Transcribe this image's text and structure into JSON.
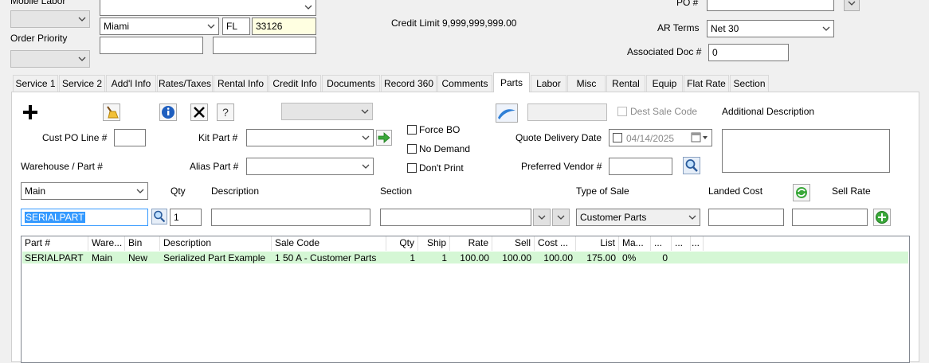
{
  "header": {
    "mobile_labor_label": "Mobile Labor",
    "mobile_labor_value": "",
    "order_priority_label": "Order Priority",
    "order_priority_value": "",
    "address_line": "",
    "city": "Miami",
    "state": "FL",
    "zip": "33126",
    "extra1": "",
    "extra2": "",
    "credit_limit": "Credit Limit 9,999,999,999.00",
    "po_label": "PO #",
    "po_value": "",
    "ar_terms_label": "AR Terms",
    "ar_terms_value": "Net 30",
    "assoc_doc_label": "Associated Doc #",
    "assoc_doc_value": "0"
  },
  "tabs": [
    {
      "label": "Service 1"
    },
    {
      "label": "Service 2"
    },
    {
      "label": "Add'l Info"
    },
    {
      "label": "Rates/Taxes"
    },
    {
      "label": "Rental Info"
    },
    {
      "label": "Credit Info"
    },
    {
      "label": "Documents"
    },
    {
      "label": "Record 360"
    },
    {
      "label": "Comments"
    },
    {
      "label": "Parts",
      "active": true
    },
    {
      "label": "Labor"
    },
    {
      "label": "Misc"
    },
    {
      "label": "Rental"
    },
    {
      "label": "Equip"
    },
    {
      "label": "Flat Rate"
    },
    {
      "label": "Section"
    }
  ],
  "parts": {
    "top_combo_value": "",
    "dest_sale_code_label": "Dest Sale Code",
    "dest_sale_code_value": "",
    "additional_description_label": "Additional Description",
    "additional_description_value": "",
    "cust_po_line_label": "Cust PO Line #",
    "cust_po_line_value": "",
    "kit_part_label": "Kit Part #",
    "kit_part_value": "",
    "alias_part_label": "Alias Part #",
    "alias_part_value": "",
    "force_bo_label": "Force BO",
    "no_demand_label": "No Demand",
    "dont_print_label": "Don't Print",
    "quote_delivery_label": "Quote Delivery Date",
    "quote_delivery_value": "04/14/2025",
    "preferred_vendor_label": "Preferred Vendor #",
    "preferred_vendor_value": "",
    "warehouse_part_label": "Warehouse / Part #",
    "warehouse_value": "Main",
    "part_value": "SERIALPART",
    "qty_label": "Qty",
    "qty_value": "1",
    "description_label": "Description",
    "description_value": "",
    "section_label": "Section",
    "section_value": "",
    "type_of_sale_label": "Type of Sale",
    "type_of_sale_value": "Customer Parts",
    "landed_cost_label": "Landed Cost",
    "landed_cost_value": "",
    "sell_rate_label": "Sell Rate",
    "sell_rate_value": ""
  },
  "grid": {
    "columns": [
      "Part #",
      "Ware...",
      "Bin",
      "Description",
      "Sale Code",
      "Qty",
      "Ship",
      "Rate",
      "Sell",
      "Cost ...",
      "List",
      "Ma...",
      "...",
      "...",
      "..."
    ],
    "rows": [
      {
        "part": "SERIALPART",
        "warehouse": "Main",
        "bin": "New",
        "description": "Serialized Part Example",
        "sale_code": "1 50 A - Customer Parts",
        "qty": "1",
        "ship": "1",
        "rate": "100.00",
        "sell": "100.00",
        "cost": "100.00",
        "list": "175.00",
        "margin": "0%",
        "extra": "0"
      }
    ]
  },
  "icons": {
    "add": "plus-icon",
    "clear": "broom-icon",
    "info": "info-icon",
    "delete": "x-icon",
    "help": "question-icon",
    "kit_go": "green-arrow-icon",
    "vendor_search": "magnifier-icon",
    "part_search": "magnifier-icon",
    "refresh": "refresh-icon",
    "add_row": "green-plus-icon",
    "flag": "blue-swoosh-icon"
  },
  "colors": {
    "required_field": "#ffffe1",
    "row_highlight": "#d5f7d5",
    "selection": "#3399ff"
  }
}
